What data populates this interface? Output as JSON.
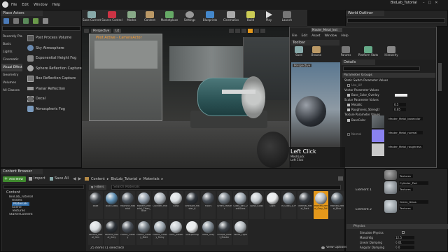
{
  "window": {
    "title": "BioLab_Tutorial",
    "logo": "UE"
  },
  "menu": [
    "File",
    "Edit",
    "Window",
    "Help"
  ],
  "modes": {
    "tab": "Place Actors",
    "categories": [
      "Recently Placed",
      "Basic",
      "Lights",
      "Cinematic",
      "Visual Effects",
      "Geometry",
      "Volumes",
      "All Classes"
    ],
    "active_category": "Visual Effects",
    "items": [
      "Post Process Volume",
      "Sky Atmosphere",
      "Exponential Height Fog",
      "Sphere Reflection Capture",
      "Box Reflection Capture",
      "Planar Reflection",
      "Decal",
      "Atmospheric Fog"
    ]
  },
  "toolbar": {
    "buttons": [
      "Save Current",
      "Source Control",
      "Modes",
      "Content",
      "Marketplace",
      "Settings",
      "Blueprints",
      "Cinematics",
      "Build",
      "Play",
      "Launch"
    ]
  },
  "viewport": {
    "mode": "Perspective",
    "view": "Lit",
    "status": "Pilot Active - CameraActor",
    "overlay_title": "Left Click",
    "overlay_lines": [
      "MeshLock",
      "Left Click"
    ]
  },
  "world_outliner": {
    "title": "World Outliner"
  },
  "material_editor": {
    "tab": "Master_Metal_Inst",
    "menu": [
      "File",
      "Edit",
      "Asset",
      "Window",
      "Help"
    ],
    "toolbar_title": "Toolbar",
    "toolbar_buttons": [
      "Save",
      "Browse",
      "Params",
      "Platform Stats",
      "Hierarchy"
    ],
    "viewport_label": "Perspective",
    "details_title": "Details",
    "groups": {
      "parameter_groups": "Parameter Groups",
      "static_switch": "Static Switch Parameter Values",
      "use_uv": "Use_UV",
      "vector_params": "Vector Parameter Values",
      "base_color": "Base_Color_Overlay",
      "scalar_params": "Scalar Parameter Values",
      "metallic": "Metallic",
      "metallic_value": "0.5",
      "roughness": "Roughness_Strength",
      "roughness_value": "0.65",
      "texture_params": "Texture Parameter Values",
      "basecolor": "BaseColor",
      "normal": "Normal",
      "tex_base": "Master_Metal_basecolor",
      "tex_normal": "Master_Metal_normal",
      "tex_rough": "Master_Metal_roughness"
    }
  },
  "right_panel": {
    "element1": "Element 1",
    "element2": "Element 2",
    "clear_glass": "Cylinder_Pod",
    "green_glass": "Green_Glass",
    "textures_label": "Textures",
    "physics_title": "Physics",
    "simulate_physics": "Simulate Physics",
    "mass": "MassInKg",
    "mass_value": "12.5",
    "linear_damping": "Linear Damping",
    "linear_value": "0.01",
    "angular_damping": "Angular Damping",
    "angular_value": "0.0"
  },
  "content_browser": {
    "tab": "Content Browser",
    "add_new": "Add New",
    "import": "Import",
    "save_all": "Save All",
    "path": [
      "Content",
      "BioLab_Tutorial",
      "Materials"
    ],
    "filters": "Filters",
    "search_placeholder": "Search Materials",
    "tree": [
      "Content",
      "BioLab_Tutorial",
      "Assets",
      "Materials",
      "Scene",
      "Textures",
      "StarterContent"
    ],
    "assets_row1": [
      "Base",
      "Blue_Glass",
      "Machine_Material",
      "Modern_Material_Clean_Blue",
      "Cylinder_Pod",
      "Glass",
      "Emissive_Master_A",
      "Floors",
      "Green_Master",
      "Glass_Bell_DarkGlass",
      "Glass_Glass",
      "Light",
      "M_Glass_LOP",
      "Thermal_Metal_Dark",
      "Painted_Metal_Grey_Ddl",
      "Painted_Metal_Blue"
    ],
    "assets_row2": [
      "Painted_Metal_Gen",
      "Painted_Metal_Grey",
      "Plastic_Glossy",
      "Plastic_Glossy_Matt",
      "Plastic_Glossy_Shiny",
      "Plant_Holder",
      "Sharpening",
      "Toma_Grey",
      "Unique_Asset_Master",
      "White_Light"
    ],
    "selected": "Painted_Metal_Grey_Ddl",
    "status": "25 items (1 selected)",
    "view_options": "View Options"
  },
  "colors": {
    "accent_orange": "#e4981b",
    "ue_blue": "#2d6ba8",
    "bg": "#151515",
    "panel": "#242424"
  }
}
